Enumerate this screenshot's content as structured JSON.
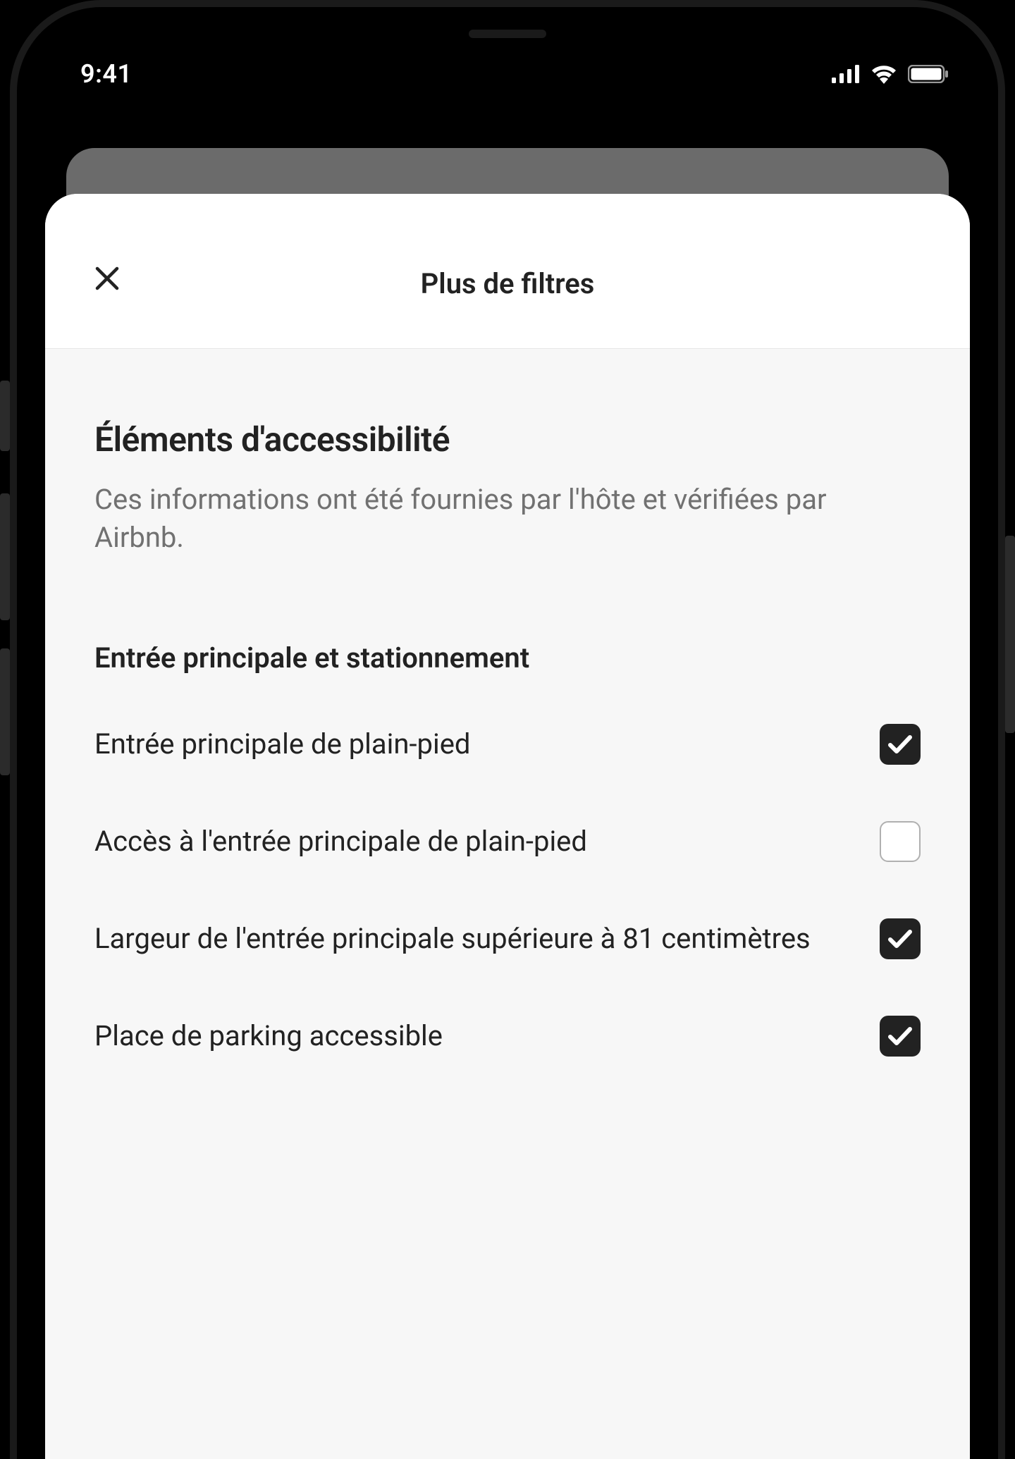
{
  "status_bar": {
    "time": "9:41"
  },
  "sheet": {
    "title": "Plus de filtres",
    "section": {
      "title": "Éléments d'accessibilité",
      "description": "Ces informations ont été fournies par l'hôte et vérifiées par Airbnb."
    },
    "subsection": {
      "title": "Entrée principale et stationnement",
      "filters": [
        {
          "label": "Entrée principale de plain-pied",
          "checked": true
        },
        {
          "label": "Accès à l'entrée principale de plain-pied",
          "checked": false
        },
        {
          "label": "Largeur de l'entrée principale supérieure à 81 centimètres",
          "checked": true
        },
        {
          "label": "Place de parking accessible",
          "checked": true
        }
      ]
    }
  }
}
